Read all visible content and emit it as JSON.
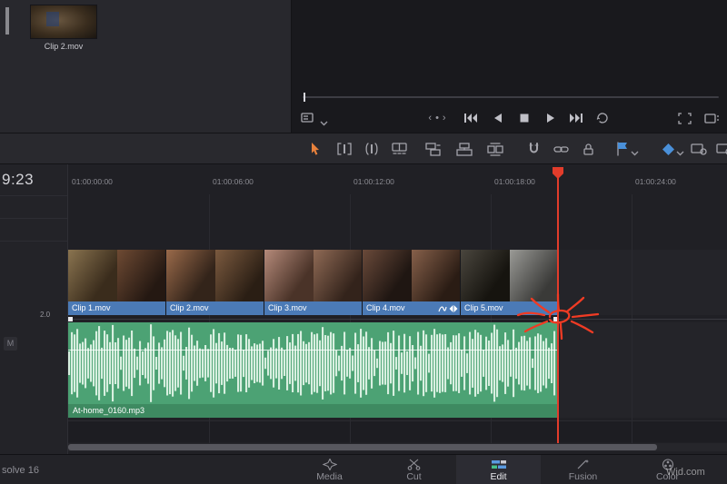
{
  "colors": {
    "clip_label_blue": "#4b7ab6",
    "audio_green": "#4ca274",
    "playhead_red": "#e23c2b",
    "flag_blue": "#4a90d9",
    "active_tool_orange": "#e8813c"
  },
  "media_pool": {
    "clip_label": "Clip 2.mov"
  },
  "timeline": {
    "timecode": "9:23",
    "ruler_labels": [
      "01:00:00:00",
      "01:00:06:00",
      "01:00:12:00",
      "01:00:18:00",
      "01:00:24:00"
    ],
    "video_clips": [
      {
        "label": "Clip 1.mov"
      },
      {
        "label": "Clip 2.mov"
      },
      {
        "label": "Clip 3.mov"
      },
      {
        "label": "Clip 4.mov"
      },
      {
        "label": "Clip 5.mov"
      }
    ],
    "audio_clip": {
      "label": "At-home_0160.mp3"
    },
    "audio_level": "2.0",
    "mute_label": "M"
  },
  "pages": {
    "active": "Edit",
    "tabs": [
      {
        "label": "Media"
      },
      {
        "label": "Cut"
      },
      {
        "label": "Edit"
      },
      {
        "label": "Fusion"
      },
      {
        "label": "Color"
      }
    ]
  },
  "footer": {
    "brand": "solve 16",
    "watermark": "Wid.com"
  }
}
